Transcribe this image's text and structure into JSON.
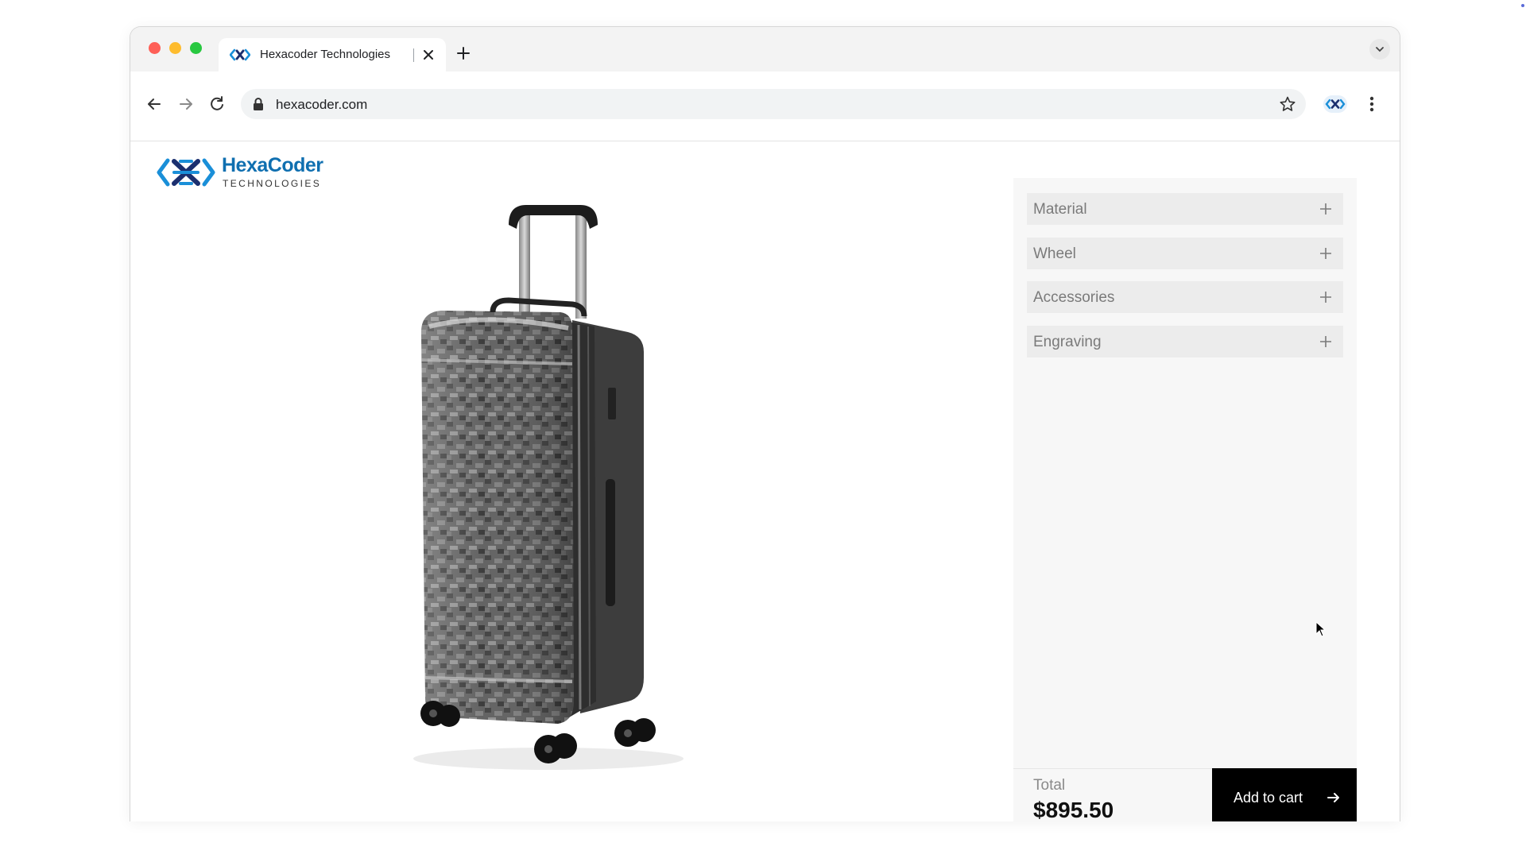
{
  "browser": {
    "tab_title": "Hexacoder Technologies",
    "url": "hexacoder.com",
    "icons": {
      "favicon": "hexacoder-favicon-icon",
      "close": "close-icon",
      "new_tab": "plus-icon",
      "back": "arrow-left-icon",
      "forward": "arrow-right-icon",
      "reload": "reload-icon",
      "lock": "lock-icon",
      "bookmark": "star-icon",
      "extension": "hexacoder-extension-icon",
      "menu": "kebab-menu-icon",
      "tab_dropdown": "chevron-down-icon"
    }
  },
  "brand": {
    "name": "HexaCoder",
    "subtitle": "TECHNOLOGIES",
    "colors": {
      "primary": "#0f6fb0",
      "secondary": "#1b2f6e"
    }
  },
  "product": {
    "image": "carry-on-suitcase-image"
  },
  "configurator": {
    "options": [
      {
        "label": "Material"
      },
      {
        "label": "Wheel"
      },
      {
        "label": "Accessories"
      },
      {
        "label": "Engraving"
      }
    ],
    "total_label": "Total",
    "total_price": "$895.50",
    "add_to_cart_label": "Add to cart"
  }
}
